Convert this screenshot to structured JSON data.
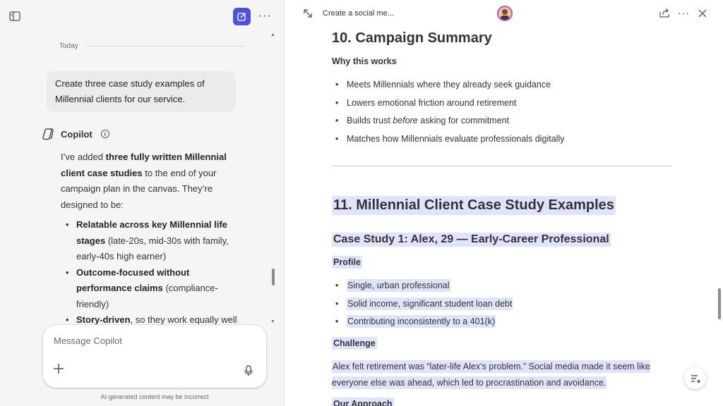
{
  "left_pane": {
    "today_label": "Today",
    "user_message": "Create three case study examples of Millennial clients for our service.",
    "copilot_name": "Copilot",
    "reply": {
      "intro_pre": "I’ve added ",
      "intro_bold": "three fully written Millennial client case studies",
      "intro_post": " to the end of your campaign plan in the canvas. They’re designed to be:",
      "bullets": [
        {
          "bold": "Relatable across key Millennial life stages",
          "rest": " (late-20s, mid-30s with family, early-40s high earner)"
        },
        {
          "bold": "Outcome-focused without performance claims",
          "rest": " (compliance-friendly)"
        },
        {
          "bold": "Story-driven",
          "rest": ", so they work equally well for:"
        }
      ]
    },
    "composer_placeholder": "Message Copilot",
    "disclaimer": "AI-generated content may be incorrect"
  },
  "canvas": {
    "title": "Create a social me...",
    "section10_heading": "10. Campaign Summary",
    "why_heading": "Why this works",
    "why_bullets": [
      {
        "pre": "Meets Millennials where they already seek guidance",
        "em": "",
        "post": ""
      },
      {
        "pre": "Lowers emotional friction around retirement",
        "em": "",
        "post": ""
      },
      {
        "pre": "Builds trust ",
        "em": "before",
        "post": " asking for commitment"
      },
      {
        "pre": "Matches how Millennials evaluate professionals digitally",
        "em": "",
        "post": ""
      }
    ],
    "section11_heading": "11. Millennial Client Case Study Examples",
    "case1_heading": "Case Study 1: Alex, 29 — Early-Career Professional",
    "profile_heading": "Profile",
    "profile_bullets": [
      "Single, urban professional",
      "Solid income, significant student loan debt",
      "Contributing inconsistently to a 401(k)"
    ],
    "challenge_heading": "Challenge",
    "challenge_text": "Alex felt retirement was “later-life Alex’s problem.” Social media made it seem like everyone else was ahead, which led to procrastination and avoidance.",
    "approach_heading": "Our Approach"
  },
  "colors": {
    "accent": "#4f52d9",
    "highlight": "#dfe3fb",
    "avatar_ring": "#c050c6"
  }
}
